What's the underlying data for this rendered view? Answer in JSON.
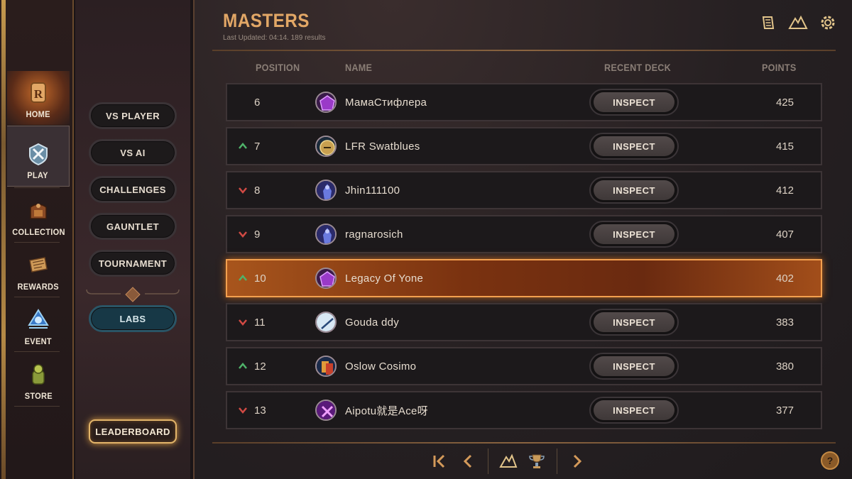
{
  "nav": {
    "items": [
      {
        "label": "HOME",
        "icon": "home-icon"
      },
      {
        "label": "PLAY",
        "icon": "play-icon"
      },
      {
        "label": "COLLECTION",
        "icon": "collection-icon"
      },
      {
        "label": "REWARDS",
        "icon": "rewards-icon"
      },
      {
        "label": "EVENT",
        "icon": "event-icon"
      },
      {
        "label": "STORE",
        "icon": "store-icon"
      }
    ]
  },
  "submenu": {
    "items": [
      "VS PLAYER",
      "VS AI",
      "CHALLENGES",
      "GAUNTLET",
      "TOURNAMENT"
    ],
    "labs": "LABS",
    "leaderboard": "LEADERBOARD"
  },
  "header": {
    "title": "MASTERS",
    "subtitle": "Last Updated: 04:14. 189 results"
  },
  "table": {
    "columns": {
      "position": "POSITION",
      "name": "NAME",
      "recent_deck": "RECENT DECK",
      "points": "POINTS"
    },
    "inspect_label": "INSPECT",
    "rows": [
      {
        "position": "6",
        "name": "МамаСтифлера",
        "points": "425",
        "trend": "none",
        "avatar": "purple-gem"
      },
      {
        "position": "7",
        "name": "LFR Swatblues",
        "points": "415",
        "trend": "up",
        "avatar": "gold-crest"
      },
      {
        "position": "8",
        "name": "Jhin111100",
        "points": "412",
        "trend": "down",
        "avatar": "blue-figure"
      },
      {
        "position": "9",
        "name": "ragnarosich",
        "points": "407",
        "trend": "down",
        "avatar": "blue-figure"
      },
      {
        "position": "10",
        "name": "Legacy Of Yone",
        "points": "402",
        "trend": "up",
        "avatar": "purple-gem",
        "highlighted": true
      },
      {
        "position": "11",
        "name": "Gouda ddy",
        "points": "383",
        "trend": "down",
        "avatar": "white-sword"
      },
      {
        "position": "12",
        "name": "Oslow Cosimo",
        "points": "380",
        "trend": "up",
        "avatar": "cards"
      },
      {
        "position": "13",
        "name": "Aipotu就是Ace呀",
        "points": "377",
        "trend": "down",
        "avatar": "purple-cross"
      }
    ]
  },
  "pager": {
    "help": "?"
  },
  "colors": {
    "accent": "#e2a766",
    "trend_up": "#4fb36a",
    "trend_down": "#d14a44",
    "highlight": "#a8551c"
  }
}
